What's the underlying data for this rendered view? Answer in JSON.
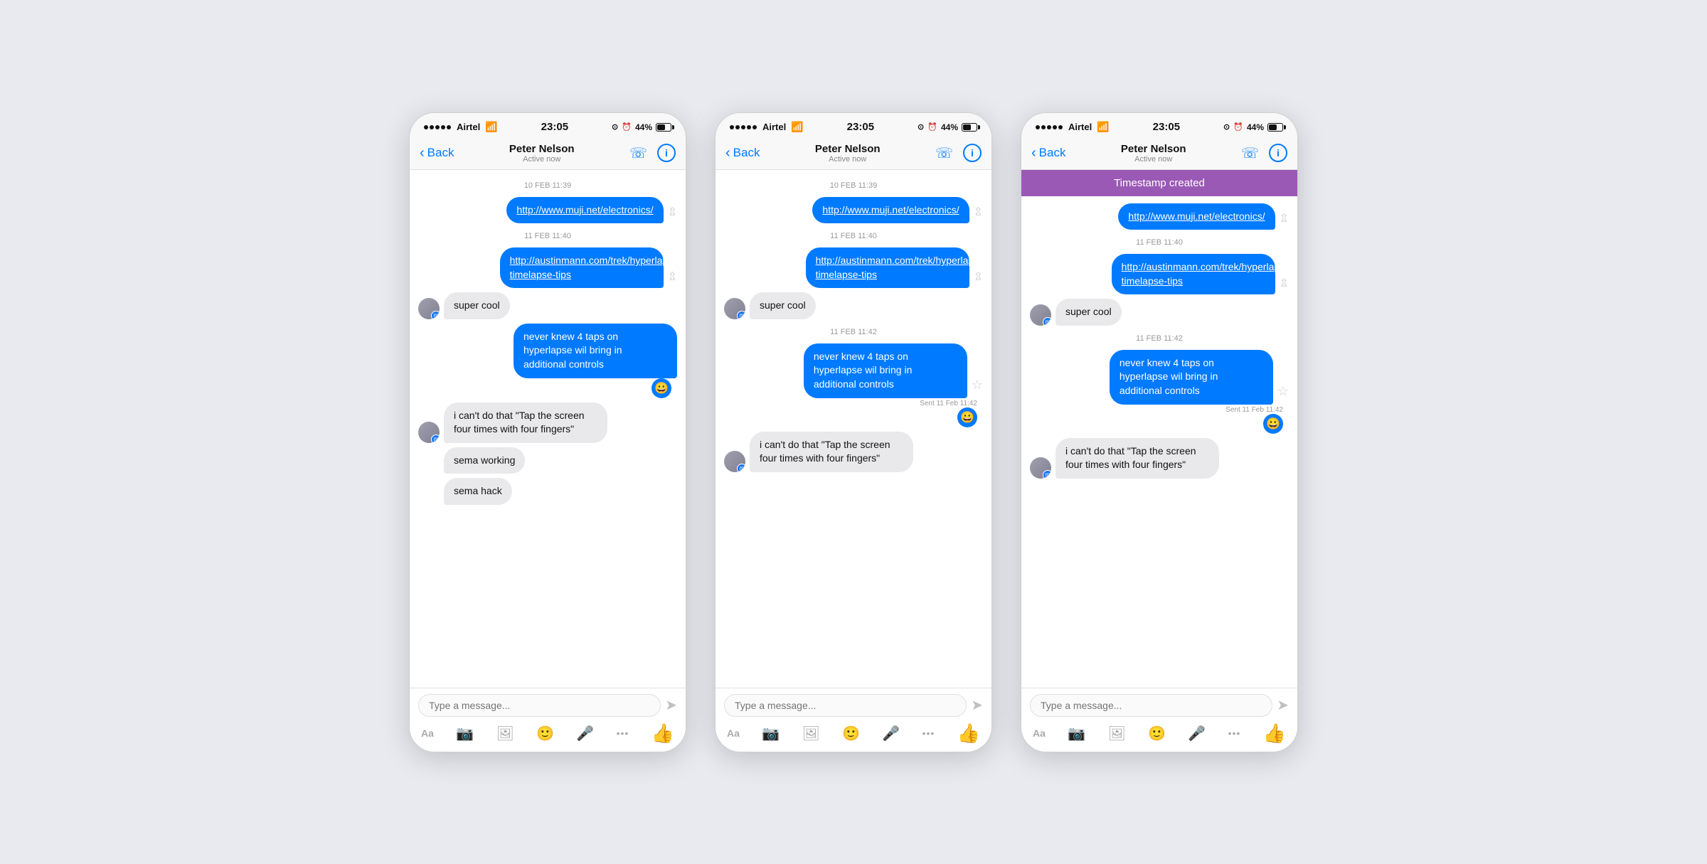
{
  "page": {
    "background": "#e8eaf0"
  },
  "phones": [
    {
      "id": "phone1",
      "statusBar": {
        "carrier": "Airtel",
        "time": "23:05",
        "battery": "44%"
      },
      "nav": {
        "back": "Back",
        "name": "Peter Nelson",
        "status": "Active now"
      },
      "timestampBanner": null,
      "messages": [
        {
          "type": "timestamp",
          "text": "10 FEB 11:39"
        },
        {
          "type": "sent-link",
          "text": "http://www.muji.net/electronics/"
        },
        {
          "type": "timestamp",
          "text": "11 FEB 11:40"
        },
        {
          "type": "sent-link",
          "text": "http://austinmann.com/trek/hyperlapse-timelapse-tips"
        },
        {
          "type": "received",
          "text": "super cool",
          "hasAvatar": true
        },
        {
          "type": "sent",
          "text": "never knew 4 taps on hyperlapse wil bring in additional controls",
          "emoji": "😀"
        },
        {
          "type": "received",
          "text": "i can't do that \"Tap the screen four times with four fingers\"",
          "hasAvatar": true
        },
        {
          "type": "received-no-avatar",
          "text": "sema working"
        },
        {
          "type": "received-no-avatar",
          "text": "sema hack"
        }
      ],
      "input": {
        "placeholder": "Type a message..."
      }
    },
    {
      "id": "phone2",
      "statusBar": {
        "carrier": "Airtel",
        "time": "23:05",
        "battery": "44%"
      },
      "nav": {
        "back": "Back",
        "name": "Peter Nelson",
        "status": "Active now"
      },
      "timestampBanner": null,
      "messages": [
        {
          "type": "timestamp",
          "text": "10 FEB 11:39"
        },
        {
          "type": "sent-link",
          "text": "http://www.muji.net/electronics/"
        },
        {
          "type": "timestamp",
          "text": "11 FEB 11:40"
        },
        {
          "type": "sent-link",
          "text": "http://austinmann.com/trek/hyperlapse-timelapse-tips"
        },
        {
          "type": "received",
          "text": "super cool",
          "hasAvatar": true
        },
        {
          "type": "timestamp",
          "text": "11 FEB 11:42"
        },
        {
          "type": "sent-star",
          "text": "never knew 4 taps on hyperlapse wil bring in additional controls",
          "emoji": "😀",
          "sentLabel": "Sent 11 Feb 11:42"
        },
        {
          "type": "received",
          "text": "i can't do that \"Tap the screen four times with four fingers\"",
          "hasAvatar": true
        }
      ],
      "input": {
        "placeholder": "Type a message..."
      }
    },
    {
      "id": "phone3",
      "statusBar": {
        "carrier": "Airtel",
        "time": "23:05",
        "battery": "44%"
      },
      "nav": {
        "back": "Back",
        "name": "Peter Nelson",
        "status": "Active now"
      },
      "timestampBanner": "Timestamp created",
      "messages": [
        {
          "type": "sent-link",
          "text": "http://www.muji.net/electronics/"
        },
        {
          "type": "timestamp",
          "text": "11 FEB 11:40"
        },
        {
          "type": "sent-link",
          "text": "http://austinmann.com/trek/hyperlapse-timelapse-tips"
        },
        {
          "type": "received",
          "text": "super cool",
          "hasAvatar": true
        },
        {
          "type": "timestamp",
          "text": "11 FEB 11:42"
        },
        {
          "type": "sent-star",
          "text": "never knew 4 taps on hyperlapse wil bring in additional controls",
          "emoji": "😀",
          "sentLabel": "Sent 11 Feb 11:42"
        },
        {
          "type": "received",
          "text": "i can't do that \"Tap the screen four times with four fingers\"",
          "hasAvatar": true
        }
      ],
      "input": {
        "placeholder": "Type a message..."
      }
    }
  ],
  "toolbar": {
    "aa": "Aa",
    "camera": "📷",
    "photo": "🖼",
    "emoji": "🙂",
    "mic": "🎤",
    "more": "•••",
    "like": "👍",
    "send": "➤"
  }
}
